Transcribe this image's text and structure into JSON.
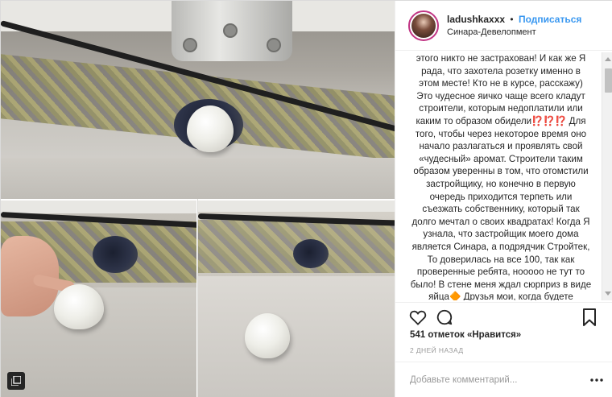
{
  "header": {
    "username": "ladushkaxxx",
    "separator": "•",
    "follow_label": "Подписаться",
    "location": "Синара-Девелопмент"
  },
  "caption": {
    "text": "этого никто не застрахован! И как же Я рада, что захотела розетку именно в этом месте! Кто не в курсе, расскажу) Это чудесное яичко чаще всего кладут строители, которым недоплатили или каким то образом обидели⁉️⁉️⁉️ Для того, чтобы через некоторое время оно начало разлагаться и проявлять свой «чудесный» аромат. Строители таким образом уверенны в том, что отомстили застройщику, но конечно в первую очередь приходится терпеть или съезжать собственнику, который так долго мечтал о своих квадратах! Когда Я узнала, что застройщик моего дома является Синара, а подрядчик Стройтек, То доверилась на все 100, так как проверенные ребята, нооооо не тут то было! В стене меня ждал сюрприз в виде яйца🔶 Друзья мои, когда будете покупать Квартиру у СИНАРЫ ИЛИ"
  },
  "actions": {
    "like_icon": "heart-icon",
    "comment_icon": "comment-icon",
    "save_icon": "bookmark-icon"
  },
  "likes": {
    "text": "541 отметок «Нравится»"
  },
  "timestamp": "2 ДНЕЙ НАЗАД",
  "comment": {
    "placeholder": "Добавьте комментарий...",
    "more_icon": "more-dots-icon"
  },
  "media": {
    "multi_image_icon": "gallery-icon"
  },
  "colors": {
    "accent": "#3897f0",
    "text": "#262626",
    "muted": "#999999"
  }
}
